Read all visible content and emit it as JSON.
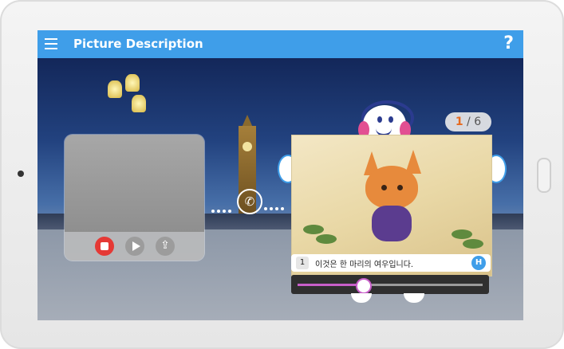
{
  "header": {
    "title": "Picture Description",
    "help_glyph": "?"
  },
  "icons": {
    "menu": "hamburger-menu-icon",
    "help": "help-icon",
    "record": "stop-record-icon",
    "play": "play-icon",
    "share": "share-icon",
    "call": "phone-call-icon",
    "next_hint": "character-headphones-icon"
  },
  "counter": {
    "current": "1",
    "separator": "/",
    "total": "6"
  },
  "caption": {
    "index": "1",
    "text": "이것은 한 마리의 여우입니다.",
    "hint_button": "H"
  },
  "audio": {
    "progress_fraction": 0.35
  },
  "colors": {
    "header_blue": "#3f9ee9",
    "record_red": "#e53935",
    "progress_purple": "#c85ec9",
    "counter_orange": "#e66a1f"
  }
}
